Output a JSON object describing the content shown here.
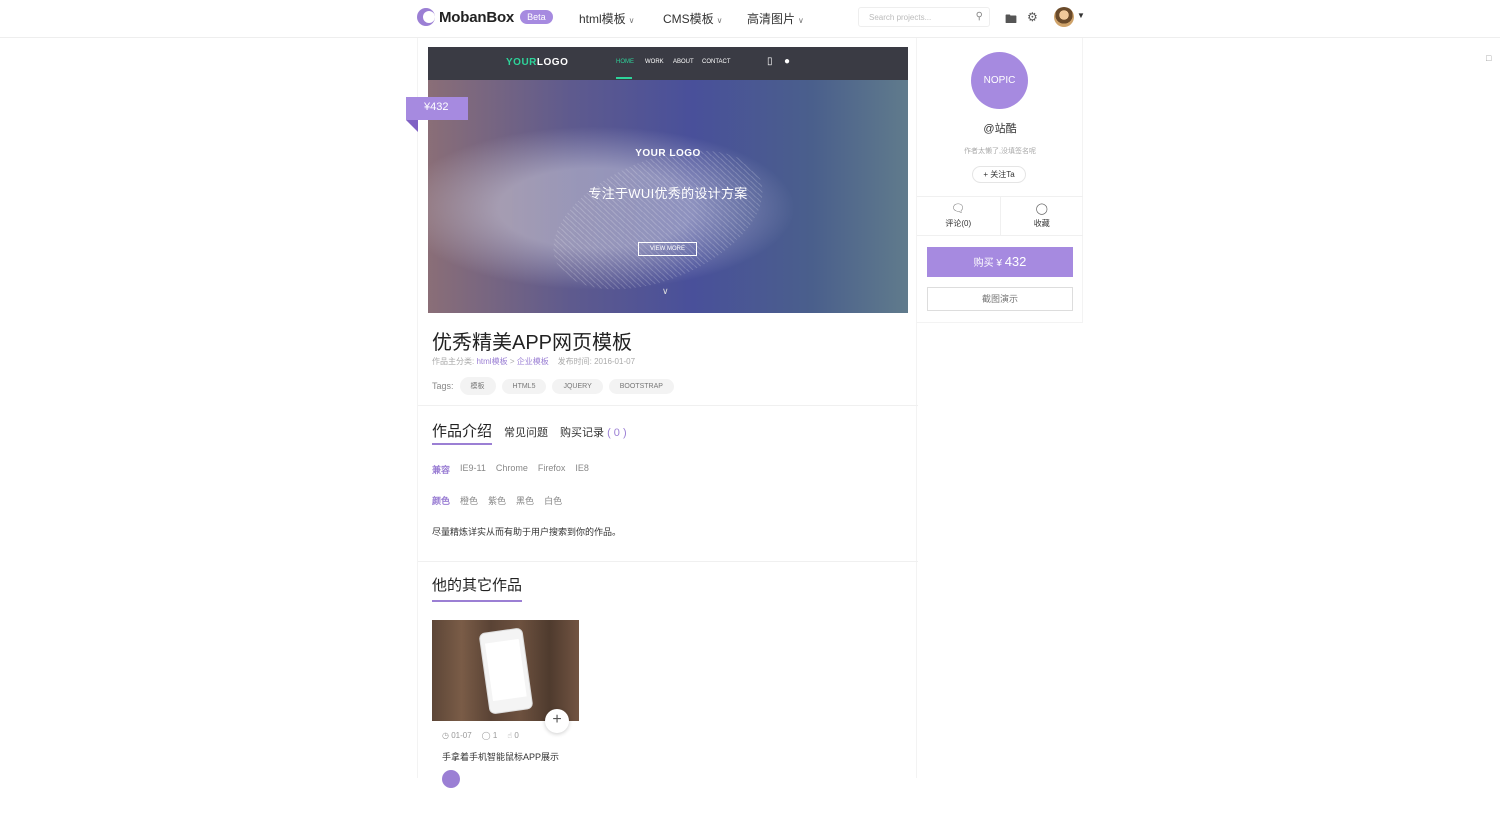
{
  "header": {
    "logo_text": "MobanBox",
    "beta_label": "Beta",
    "nav": [
      {
        "label": "html模板"
      },
      {
        "label": "CMS模板"
      },
      {
        "label": "高清图片"
      }
    ],
    "search_placeholder": "Search projects..."
  },
  "hero": {
    "price_tag": "¥432",
    "preview": {
      "logo_a": "YOUR",
      "logo_b": "LOGO",
      "menu": [
        "HOME",
        "WORK",
        "ABOUT",
        "CONTACT"
      ],
      "brand": "YOUR LOGO",
      "slogan": "专注于WUI优秀的设计方案",
      "button": "VIEW MORE"
    }
  },
  "item": {
    "title": "优秀精美APP网页模板",
    "category_label": "作品主分类:",
    "category_1": "html模板",
    "sep": ">",
    "category_2": "企业模板",
    "date_label": "发布时间:",
    "date": "2016-01-07",
    "tags_label": "Tags:",
    "tags": [
      "模板",
      "HTML5",
      "JQUERY",
      "BOOTSTRAP"
    ]
  },
  "tabs": {
    "intro": "作品介绍",
    "faq": "常见问题",
    "records": "购买记录",
    "records_count": "( 0 )"
  },
  "details": {
    "compat_label": "兼容",
    "compat": [
      "IE9-11",
      "Chrome",
      "Firefox",
      "IE8"
    ],
    "color_label": "颜色",
    "colors": [
      "橙色",
      "紫色",
      "黑色",
      "白色"
    ],
    "description": "尽量精炼详实从而有助于用户搜索到你的作品。"
  },
  "others": {
    "title": "他的其它作品",
    "card": {
      "date": "01-07",
      "comments": "1",
      "likes": "0",
      "title": "手拿着手机智能鼠标APP展示"
    }
  },
  "sidebar": {
    "avatar_text": "NOPIC",
    "username": "@站酷",
    "signature": "作者太懒了,没填签名呢",
    "follow": "+ 关注Ta",
    "comment": "评论(0)",
    "favorite": "收藏",
    "buy_label": "购买 ¥",
    "buy_amount": "432",
    "demo": "截图演示"
  }
}
